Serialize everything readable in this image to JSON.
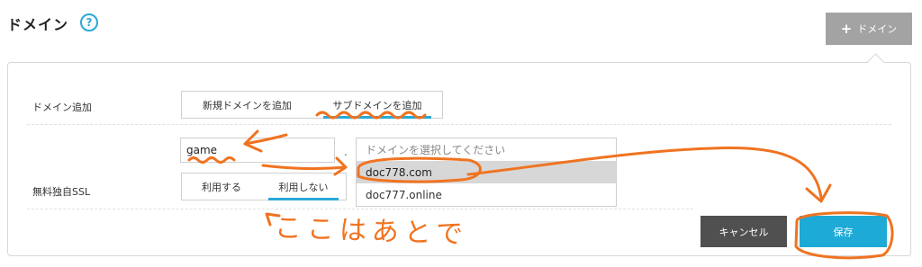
{
  "header": {
    "title": "ドメイン",
    "help_icon": "?",
    "add_button_label": "ドメイン"
  },
  "form": {
    "domain_add": {
      "label": "ドメイン追加",
      "tabs": [
        {
          "label": "新規ドメインを追加",
          "active": false
        },
        {
          "label": "サブドメインを追加",
          "active": true
        }
      ]
    },
    "subdomain": {
      "value": "game",
      "separator": "."
    },
    "domain_select": {
      "placeholder": "ドメインを選択してください",
      "options": [
        {
          "label": "doc778.com",
          "selected": true
        },
        {
          "label": "doc777.online",
          "selected": false
        }
      ]
    },
    "ssl": {
      "label": "無料独自SSL",
      "tabs": [
        {
          "label": "利用する",
          "active": false
        },
        {
          "label": "利用しない",
          "active": true
        }
      ]
    }
  },
  "actions": {
    "cancel_label": "キャンセル",
    "save_label": "保存"
  },
  "annotation": {
    "text": "ここはあとで",
    "color": "#f07320"
  },
  "colors": {
    "accent": "#1eaad6",
    "cancel": "#505050",
    "add_button": "#a3a3a3",
    "selected_row": "#d7d7d7"
  }
}
